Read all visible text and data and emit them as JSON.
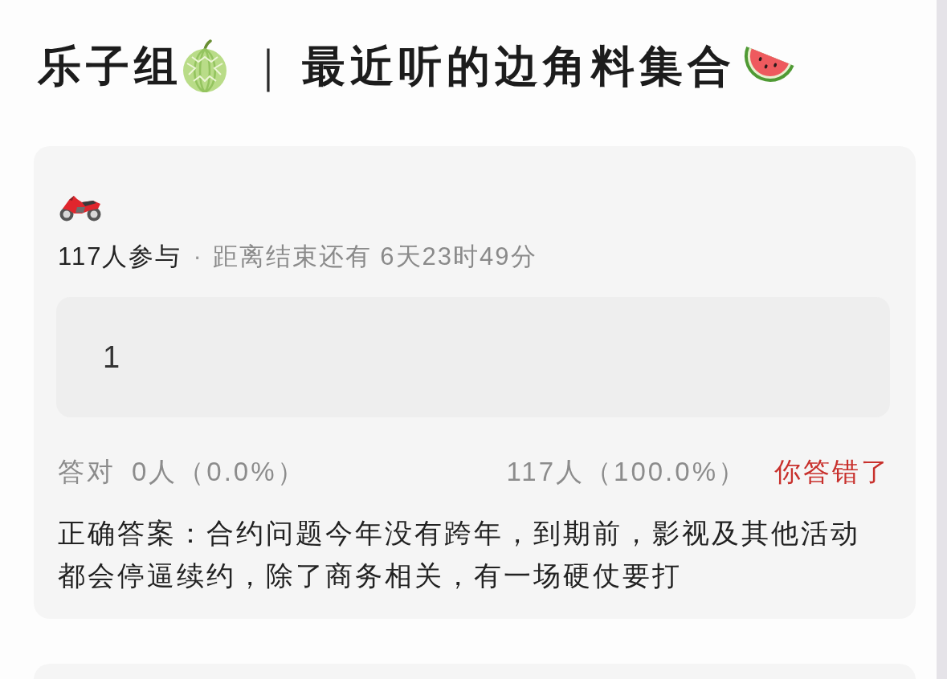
{
  "title": {
    "lead": "乐子组",
    "separator": "｜",
    "main": "最近听的边角料集合"
  },
  "poll": {
    "participants": "117人参与",
    "separator": "·",
    "countdown": "距离结束还有 6天23时49分",
    "answer": "1",
    "correct_label": "答对",
    "correct_stat": "0人（0.0%）",
    "wrong_stat": "117人（100.0%）",
    "result": "你答错了",
    "answered_correctly": false,
    "explanation": "正确答案：合约问题今年没有跨年，到期前，影视及其他活动都会停逼续约，除了商务相关，有一场硬仗要打"
  }
}
